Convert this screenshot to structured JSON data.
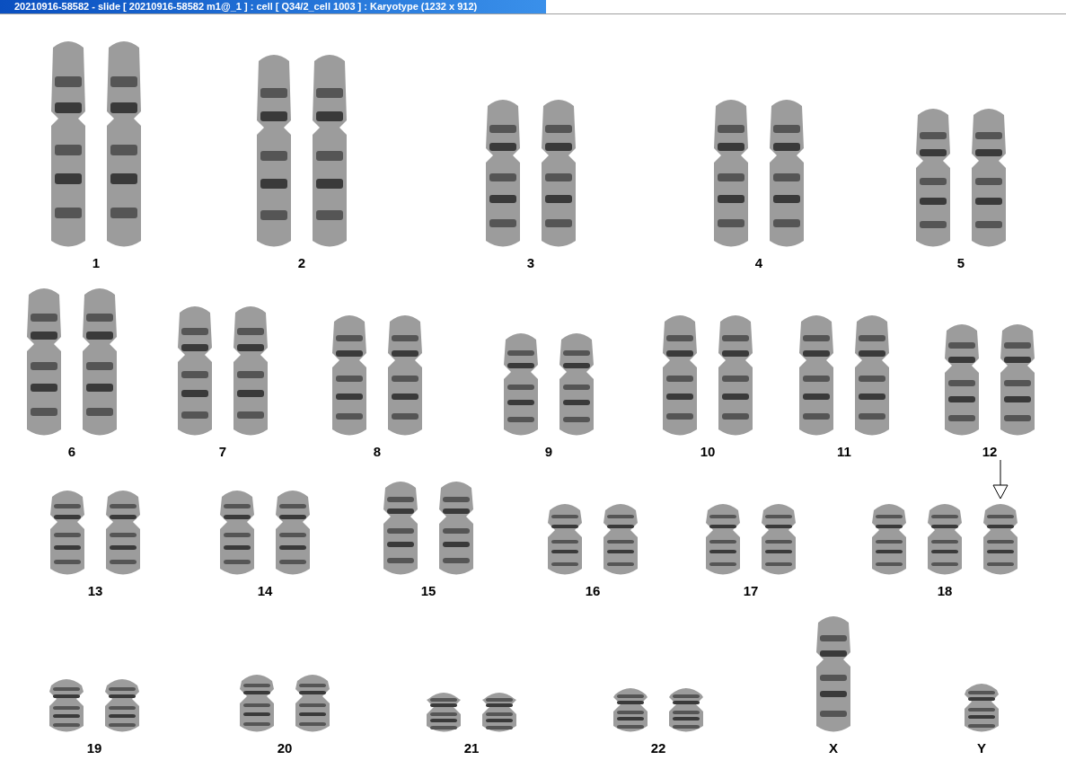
{
  "window": {
    "title": "20210916-58582 - slide [ 20210916-58582 m1@_1 ] : cell [ Q34/2_cell 1003 ] : Karyotype  (1232 x 912)"
  },
  "rows": [
    {
      "groups": [
        {
          "label": "1",
          "chromosomes": [
            {
              "marked": false
            },
            {
              "marked": false
            }
          ]
        },
        {
          "label": "2",
          "chromosomes": [
            {
              "marked": false
            },
            {
              "marked": false
            }
          ]
        },
        {
          "label": "3",
          "chromosomes": [
            {
              "marked": false
            },
            {
              "marked": false
            }
          ]
        },
        {
          "label": "4",
          "chromosomes": [
            {
              "marked": false
            },
            {
              "marked": false
            }
          ]
        },
        {
          "label": "5",
          "chromosomes": [
            {
              "marked": false
            },
            {
              "marked": false
            }
          ]
        }
      ]
    },
    {
      "groups": [
        {
          "label": "6",
          "chromosomes": [
            {
              "marked": false
            },
            {
              "marked": false
            }
          ]
        },
        {
          "label": "7",
          "chromosomes": [
            {
              "marked": false
            },
            {
              "marked": false
            }
          ]
        },
        {
          "label": "8",
          "chromosomes": [
            {
              "marked": false
            },
            {
              "marked": false
            }
          ]
        },
        {
          "label": "9",
          "chromosomes": [
            {
              "marked": false
            },
            {
              "marked": false
            }
          ]
        },
        {
          "label": "10",
          "chromosomes": [
            {
              "marked": false
            },
            {
              "marked": false
            }
          ]
        },
        {
          "label": "11",
          "chromosomes": [
            {
              "marked": false
            },
            {
              "marked": false
            }
          ]
        },
        {
          "label": "12",
          "chromosomes": [
            {
              "marked": false
            },
            {
              "marked": false
            }
          ]
        }
      ]
    },
    {
      "groups": [
        {
          "label": "13",
          "chromosomes": [
            {
              "marked": false
            },
            {
              "marked": false
            }
          ]
        },
        {
          "label": "14",
          "chromosomes": [
            {
              "marked": false
            },
            {
              "marked": false
            }
          ]
        },
        {
          "label": "15",
          "chromosomes": [
            {
              "marked": false
            },
            {
              "marked": false
            }
          ]
        },
        {
          "label": "16",
          "chromosomes": [
            {
              "marked": false
            },
            {
              "marked": false
            }
          ]
        },
        {
          "label": "17",
          "chromosomes": [
            {
              "marked": false
            },
            {
              "marked": false
            }
          ]
        },
        {
          "label": "18",
          "chromosomes": [
            {
              "marked": false
            },
            {
              "marked": false
            },
            {
              "marked": true
            }
          ]
        }
      ]
    },
    {
      "groups": [
        {
          "label": "19",
          "chromosomes": [
            {
              "marked": false
            },
            {
              "marked": false
            }
          ]
        },
        {
          "label": "20",
          "chromosomes": [
            {
              "marked": false
            },
            {
              "marked": false
            }
          ]
        },
        {
          "label": "21",
          "chromosomes": [
            {
              "marked": false
            },
            {
              "marked": false
            }
          ]
        },
        {
          "label": "22",
          "chromosomes": [
            {
              "marked": false
            },
            {
              "marked": false
            }
          ]
        },
        {
          "label": "X",
          "chromosomes": [
            {
              "marked": false
            }
          ]
        },
        {
          "label": "Y",
          "chromosomes": [
            {
              "marked": false
            }
          ]
        }
      ]
    }
  ]
}
